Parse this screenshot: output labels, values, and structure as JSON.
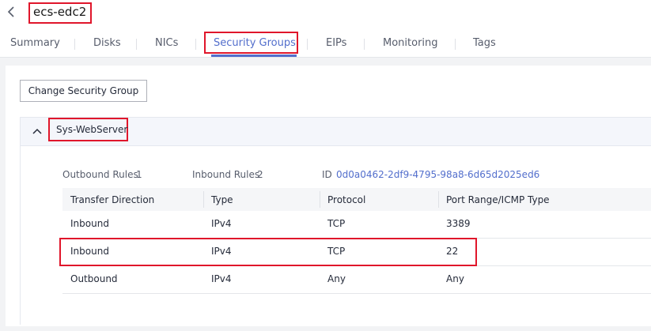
{
  "header": {
    "title": "ecs-edc2",
    "back_icon": "chevron-left-icon"
  },
  "tabs": [
    {
      "label": "Summary"
    },
    {
      "label": "Disks"
    },
    {
      "label": "NICs"
    },
    {
      "label": "Security Groups",
      "active": true
    },
    {
      "label": "EIPs"
    },
    {
      "label": "Monitoring"
    },
    {
      "label": "Tags"
    }
  ],
  "toolbar": {
    "change_security_group_label": "Change Security Group"
  },
  "security_group": {
    "name": "Sys-WebServer",
    "expanded": true,
    "chevron_icon": "chevron-up-icon",
    "outbound_rules_label": "Outbound Rules",
    "outbound_rules_count": "1",
    "inbound_rules_label": "Inbound Rules",
    "inbound_rules_count": "2",
    "id_label": "ID",
    "id_value": "0d0a0462-2df9-4795-98a8-6d65d2025ed6"
  },
  "rules_table": {
    "columns": [
      "Transfer Direction",
      "Type",
      "Protocol",
      "Port Range/ICMP Type"
    ],
    "rows": [
      [
        "Inbound",
        "IPv4",
        "TCP",
        "3389"
      ],
      [
        "Inbound",
        "IPv4",
        "TCP",
        "22"
      ],
      [
        "Outbound",
        "IPv4",
        "Any",
        "Any"
      ]
    ]
  },
  "colors": {
    "accent": "#526ecc",
    "highlight_box": "#e0162b",
    "text": "#252b3a"
  }
}
